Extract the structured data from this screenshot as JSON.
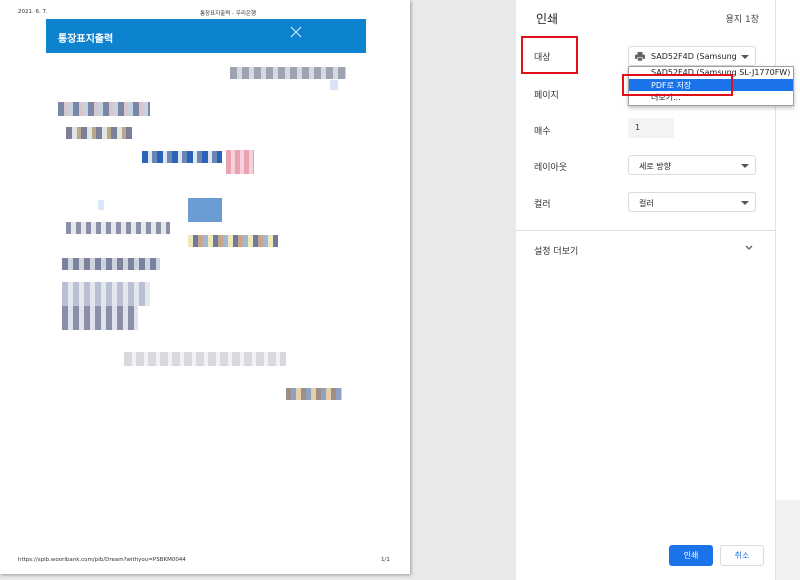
{
  "preview": {
    "header_date": "2021. 6. 7.",
    "header_title": "통장표지출력 - 우리은행",
    "banner_title": "통장표지출력",
    "footer_url": "https://spib.wooribank.com/pib/Dream?withyou=PSBKM0044",
    "footer_page": "1/1"
  },
  "panel": {
    "title": "인쇄",
    "sheet_count": "용지 1장",
    "destination_label": "대상",
    "destination_value": "SAD52F4D (Samsung",
    "pages_label": "페이지",
    "copies_label": "매수",
    "copies_value": "1",
    "layout_label": "레이아웃",
    "layout_value": "세로 방향",
    "color_label": "컬러",
    "color_value": "컬러",
    "more_settings": "설정 더보기",
    "print_button": "인쇄",
    "cancel_button": "취소"
  },
  "dropdown": {
    "options": [
      "SAD52F4D (Samsung SL-J1770FW)",
      "PDF로 저장",
      "더보기..."
    ],
    "selected": "PDF로 저장"
  },
  "colors": {
    "accent": "#1a73e8",
    "banner": "#0d82cf",
    "highlight": "#e0101a"
  },
  "icons": [
    "close-icon",
    "printer-icon",
    "caret-down-icon",
    "chevron-down-icon"
  ]
}
